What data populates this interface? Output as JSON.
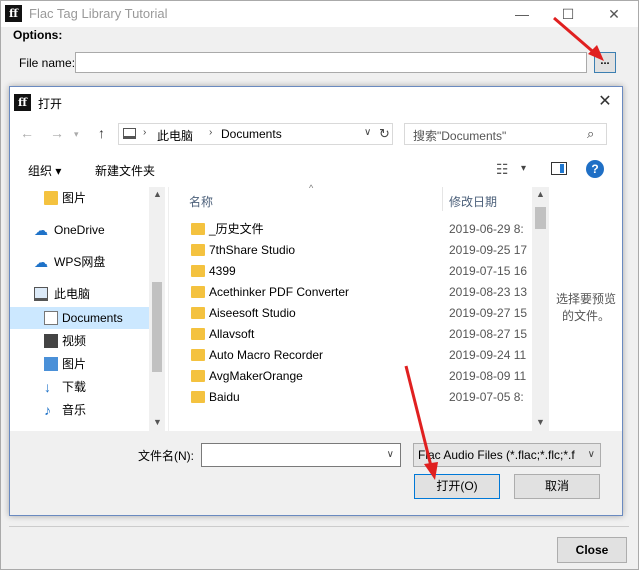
{
  "app": {
    "title": "Flac Tag Library Tutorial",
    "icon_text": "ff",
    "options_label": "Options:",
    "file_name_label": "File name:",
    "file_name_value": "",
    "browse_label": "...",
    "close_label": "Close"
  },
  "dialog": {
    "title": "打开",
    "address": {
      "crumb_pc": "此电脑",
      "crumb_folder": "Documents"
    },
    "search_placeholder": "搜索\"Documents\"",
    "toolbar": {
      "organize": "组织 ▾",
      "new_folder": "新建文件夹"
    },
    "nav_items": [
      {
        "label": "图片",
        "icon": "folder-icon"
      },
      {
        "label": "OneDrive",
        "icon": "cloud-icon"
      },
      {
        "label": "WPS网盘",
        "icon": "cloud-outline-icon"
      },
      {
        "label": "此电脑",
        "icon": "pc-icon"
      },
      {
        "label": "Documents",
        "icon": "documents-icon",
        "selected": true
      },
      {
        "label": "视频",
        "icon": "video-icon"
      },
      {
        "label": "图片",
        "icon": "pictures-icon"
      },
      {
        "label": "下载",
        "icon": "download-icon"
      },
      {
        "label": "音乐",
        "icon": "music-icon"
      }
    ],
    "columns": {
      "name": "名称",
      "date": "修改日期"
    },
    "files": [
      {
        "name": "_历史文件",
        "date": "2019-06-29 8:"
      },
      {
        "name": "7thShare Studio",
        "date": "2019-09-25 17"
      },
      {
        "name": "4399",
        "date": "2019-07-15 16"
      },
      {
        "name": "Acethinker PDF Converter",
        "date": "2019-08-23 13"
      },
      {
        "name": "Aiseesoft Studio",
        "date": "2019-09-27 15"
      },
      {
        "name": "Allavsoft",
        "date": "2019-08-27 15"
      },
      {
        "name": "Auto Macro Recorder",
        "date": "2019-09-24 11"
      },
      {
        "name": "AvgMakerOrange",
        "date": "2019-08-09 11"
      },
      {
        "name": "Baidu",
        "date": "2019-07-05 8:"
      }
    ],
    "preview_text": "选择要预览的文件。",
    "file_name_label": "文件名(N):",
    "file_name_value": "",
    "filter_value": "Flac Audio Files (*.flac;*.flc;*.f",
    "open_label": "打开(O)",
    "cancel_label": "取消"
  },
  "colors": {
    "accent": "#0078d7",
    "selected_bg": "#cce8ff",
    "arrow": "#e02020",
    "folder": "#f4c23f"
  }
}
